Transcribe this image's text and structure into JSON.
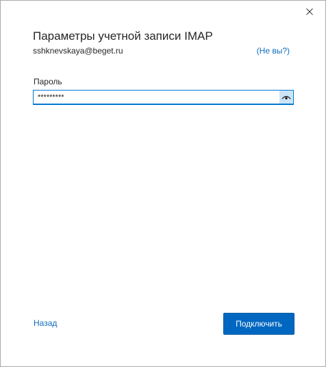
{
  "window": {
    "close_icon": "close-icon"
  },
  "dialog": {
    "title": "Параметры учетной записи IMAP",
    "email": "sshknevskaya@beget.ru",
    "not_you_link": "(Не вы?)"
  },
  "password": {
    "label": "Пароль",
    "value": "*********",
    "reveal_icon": "eye-icon"
  },
  "footer": {
    "back_link": "Назад",
    "connect_button": "Подключить"
  },
  "colors": {
    "accent": "#0067c0",
    "link": "#0f6cbd",
    "field_border": "#0078d4",
    "reveal_bg": "#cce4f7"
  }
}
